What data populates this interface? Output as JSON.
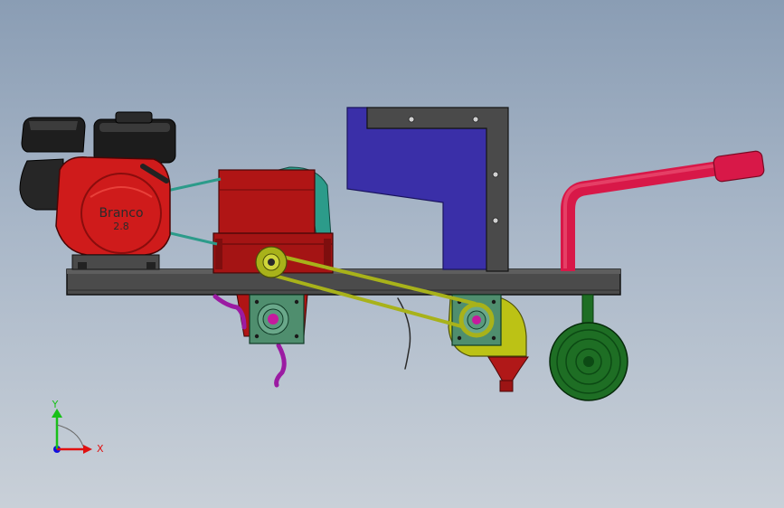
{
  "engine": {
    "brand": "Branco",
    "model": "2.8"
  },
  "triad": {
    "x_label": "X",
    "y_label": "Y"
  },
  "colors": {
    "background_top": "#8a9db4",
    "background_bottom": "#c9d0d8",
    "engine_red": "#cf1b1b",
    "frame_grey": "#4a4a4a",
    "hopper_blue": "#3a2fa8",
    "gearbox_red": "#b01515",
    "bearing_green": "#4f8e6e",
    "belt_olive": "#a8b21a",
    "chute_yellow": "#bcc215",
    "handle_red": "#d81848",
    "wheel_green": "#1e6e24",
    "hose_magenta": "#9b1ba2",
    "x_axis_red": "#e01010",
    "y_axis_green": "#18c018",
    "z_axis_blue": "#1010e0"
  }
}
